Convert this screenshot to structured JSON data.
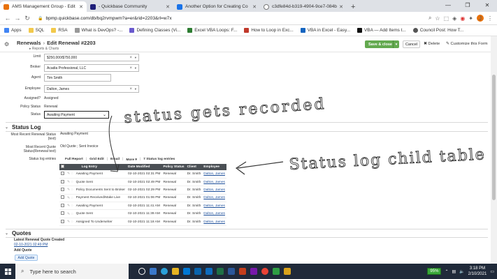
{
  "browser": {
    "tabs": [
      {
        "title": "AMS Management Group - Edit",
        "active": true,
        "color": "#e8710a"
      },
      {
        "title": "- Quickbase Community",
        "active": false,
        "color": "#1f1f7a"
      },
      {
        "title": "Another Option for Creating Co",
        "active": false,
        "color": "#1a73e8"
      },
      {
        "title": "c3dfe84d-b319-4904-9ce7-084b",
        "active": false,
        "color": "#555555"
      }
    ],
    "url": "bpmp.quickbase.com/db/bq2rvmpwm?a=er&rid=2203&rl=w7x",
    "bookmarks": [
      "Apps",
      "SQL",
      "RSA",
      "What is DevOps? -...",
      "Defining Classes (Vi...",
      "Excel VBA Loops: F...",
      "How to Loop in Exc...",
      "VBA in Excel - Easy...",
      "VBA — Add Items t...",
      "Council Post: How T..."
    ]
  },
  "header": {
    "crumb_root": "Renewals",
    "crumb_separator": "›",
    "crumb_title": "Edit Renewal #2203",
    "subcrumb": "▸ Reports & Charts",
    "save_label": "Save & close",
    "cancel_label": "Cancel",
    "delete_label": "Delete",
    "customize_label": "Customize this Form"
  },
  "form": {
    "limit_label": "Limit",
    "limit_value": "$250,000/$750,000",
    "broker_label": "Broker",
    "broker_value": "Acadia Professional, LLC",
    "agent_label": "Agent",
    "agent_value": "Tim Smith",
    "employee_label": "Employee",
    "employee_value": "Dalton, James",
    "assigned_label": "Assigned?",
    "assigned_value": "Assigned",
    "policy_status_label": "Policy Status",
    "policy_status_value": "Renewal",
    "status_label": "Status",
    "status_value": "Awaiting Payment"
  },
  "status_log": {
    "title": "Status Log",
    "recent_status_label": "Most Recent Renewal Status (text)",
    "recent_status_value": "Awaiting Payment",
    "recent_quote_label": "Most Recent Quote Status(Renewal text)",
    "recent_quote_value": "Old Quote ; Sent Invoice",
    "entries_label": "Status log entries",
    "toolbar": {
      "full_report": "Full Report",
      "grid_edit": "Grid Edit",
      "email": "Email",
      "more": "More ▾",
      "count": "7 Status log entries"
    },
    "columns": [
      "Log Entry",
      "Date Modified",
      "Policy Status",
      "Client",
      "Employee"
    ],
    "rows": [
      {
        "entry": "Awaiting Payment",
        "date": "02-10-2021 02:31 PM",
        "policy": "Renewal",
        "client": "Dr. Smith",
        "employee": "Dalton, James"
      },
      {
        "entry": "Quote Sent",
        "date": "02-10-2021 02:49 PM",
        "policy": "Renewal",
        "client": "Dr. Smith",
        "employee": "Dalton, James"
      },
      {
        "entry": "Policy Documents Sent to Broker",
        "date": "02-10-2021 02:29 PM",
        "policy": "Renewal",
        "client": "Dr. Smith",
        "employee": "Dalton, James"
      },
      {
        "entry": "Payment Received/Make Live",
        "date": "02-10-2021 01:06 PM",
        "policy": "Renewal",
        "client": "Dr. Smith",
        "employee": "Dalton, James"
      },
      {
        "entry": "Awaiting Payment",
        "date": "02-10-2021 11:41 AM",
        "policy": "Renewal",
        "client": "Dr. Smith",
        "employee": "Dalton, James"
      },
      {
        "entry": "Quote Sent",
        "date": "02-10-2021 11:39 AM",
        "policy": "Renewal",
        "client": "Dr. Smith",
        "employee": "Dalton, James"
      },
      {
        "entry": "Assigned To Underwriter",
        "date": "02-10-2021 11:18 AM",
        "policy": "Renewal",
        "client": "Dr. Smith",
        "employee": "Dalton, James"
      }
    ]
  },
  "quotes": {
    "title": "Quotes",
    "latest_label": "Latest Renewal Quote Created",
    "latest_value": "02-10-2021 02:49 PM",
    "add_quote_label": "Add Quote",
    "add_quote_button": "Add Quote"
  },
  "annotations": {
    "note1": "status gets recorded",
    "note2": "Status log child table"
  },
  "taskbar": {
    "search_placeholder": "Type here to search",
    "battery": "95%",
    "time": "3:18 PM",
    "date": "2/10/2021"
  }
}
